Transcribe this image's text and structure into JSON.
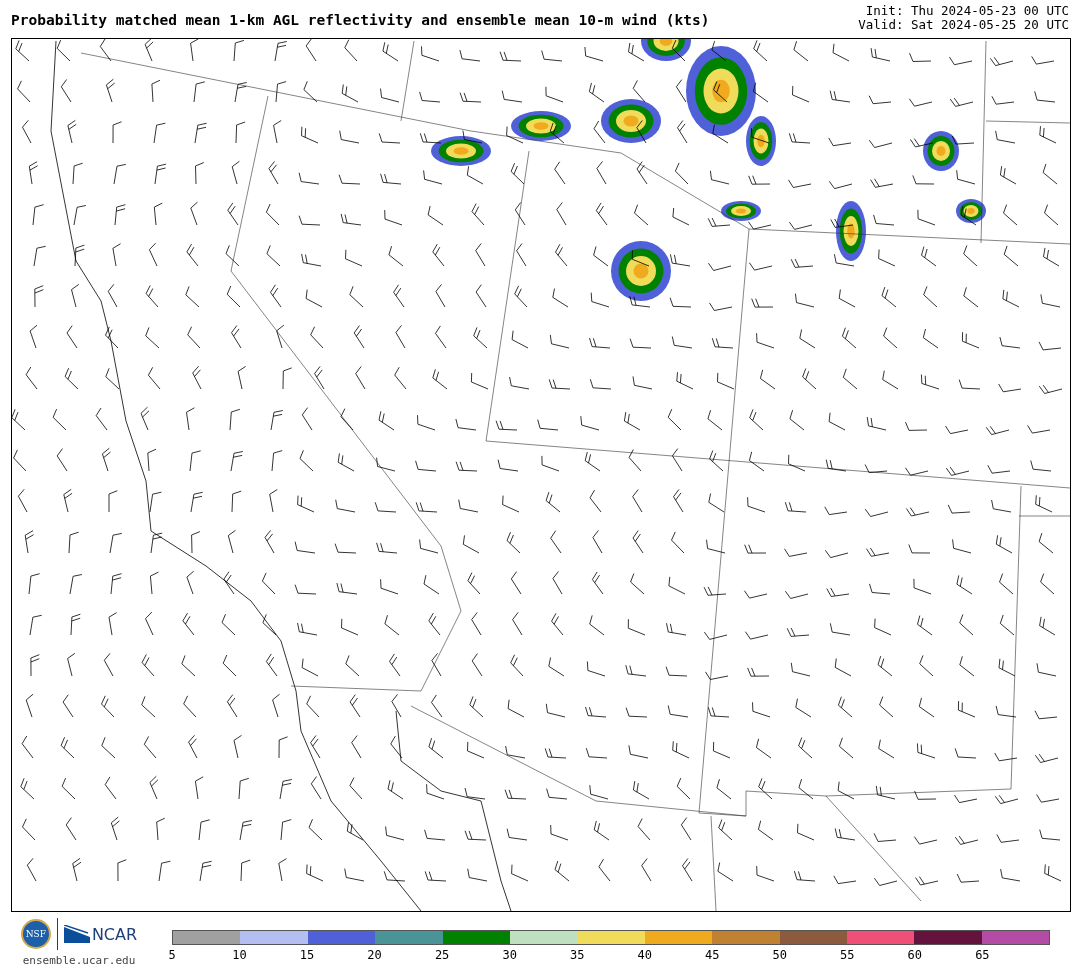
{
  "title": "Probability matched mean 1-km AGL reflectivity and ensemble mean 10-m wind (kts)",
  "init": "Init: Thu 2024-05-23 00 UTC",
  "valid": "Valid: Sat 2024-05-25 20 UTC",
  "logos": {
    "nsf": "NSF",
    "ncar": "NCAR",
    "site": "ensemble.ucar.edu"
  },
  "colorbar": [
    {
      "label": "5",
      "color": "#a0a0a0"
    },
    {
      "label": "10",
      "color": "#b4bef0"
    },
    {
      "label": "15",
      "color": "#5060d8"
    },
    {
      "label": "20",
      "color": "#4a9498"
    },
    {
      "label": "25",
      "color": "#008200"
    },
    {
      "label": "30",
      "color": "#bee0be"
    },
    {
      "label": "35",
      "color": "#f0dc5a"
    },
    {
      "label": "40",
      "color": "#f0aa1e"
    },
    {
      "label": "45",
      "color": "#be8232"
    },
    {
      "label": "50",
      "color": "#8c5a3c"
    },
    {
      "label": "55",
      "color": "#f05078"
    },
    {
      "label": "60",
      "color": "#64143c"
    },
    {
      "label": "65",
      "color": "#b44ba5"
    }
  ]
}
